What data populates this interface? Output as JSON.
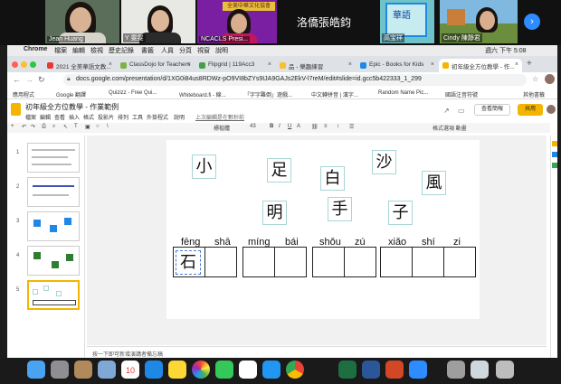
{
  "video_strip": {
    "participants": [
      "Jean Huang",
      "Y 雯雯",
      "NCACLS Presi...",
      "高宝祥",
      "Cindy 陳靜君"
    ],
    "logo_text": "全美中華文化協會",
    "book_title": "華語",
    "speaker_caption": "洛僑張皓鈞",
    "next_icon": "chevron-right-icon"
  },
  "menubar": {
    "items": [
      "Chrome",
      "檔案",
      "編輯",
      "檢視",
      "歷史記錄",
      "書籤",
      "人員",
      "分頁",
      "視窗",
      "說明"
    ],
    "clock": "週六 下午 5:08"
  },
  "browser": {
    "tabs": [
      {
        "label": "2021 全美華語文教...",
        "color": "#e53935"
      },
      {
        "label": "ClassDojo for Teachers",
        "color": "#7cb342"
      },
      {
        "label": "Flipgrid | 119Acc3",
        "color": "#43a047"
      },
      {
        "label": "品 - 樂趣練習",
        "color": "#fbc02d"
      },
      {
        "label": "Epic - Books for Kids",
        "color": "#1e88e5"
      },
      {
        "label": "初年級全方位教學 - 作...",
        "color": "#f4b400"
      }
    ],
    "url": "docs.google.com/presentation/d/1XG0i84us8RDWz-pO9VI8bZYs9IJA9GAJs2EkV-l7reM/edit#slide=id.gcc5b422333_1_299",
    "bookmarks": [
      "應用程式",
      "Google 翻譯",
      "Quizizz - Free Qui...",
      "Whiteboard.fi - 線...",
      "「字字難倒」遊戲...",
      "中文轉拼音 | 漢字...",
      "Random Name Pic...",
      "國語注音符號",
      "其他書籤"
    ]
  },
  "slides": {
    "doc_title": "初年級全方位教學 - 作業範例",
    "menu": [
      "檔案",
      "編輯",
      "查看",
      "插入",
      "格式",
      "投影片",
      "排列",
      "工具",
      "外掛程式",
      "說明"
    ],
    "last_edit": "上次編輯是在數秒前",
    "present_label": "查看簡報",
    "share_label": "共用",
    "toolbar_font": "標楷體",
    "toolbar_size": "43",
    "toolbar_right": "格式選項   動畫",
    "slide_numbers": [
      "1",
      "2",
      "3",
      "4",
      "5"
    ],
    "notes_placeholder": "按一下即可新增演講者備忘稿"
  },
  "slide": {
    "cards": [
      "小",
      "足",
      "白",
      "沙",
      "風",
      "明",
      "手",
      "子"
    ],
    "pinyin": [
      "fēng",
      "shā",
      "míng",
      "bái",
      "shǒu",
      "zú",
      "xiǎo",
      "shí",
      "zi"
    ],
    "answer_char": "石"
  },
  "dock": {
    "icons": [
      "finder-icon",
      "launchpad-icon",
      "notes-icon",
      "preview-icon",
      "calendar-icon",
      "safari-icon",
      "stickies-icon",
      "photos-icon",
      "messages-icon",
      "music-icon",
      "app-store-icon",
      "chrome-icon",
      "excel-icon",
      "word-icon",
      "powerpoint-icon",
      "zoom-icon",
      "screenshot-icon",
      "downloads-icon",
      "trash-icon"
    ],
    "calendar_day": "10"
  },
  "colors": {
    "accent_blue": "#2d8cff",
    "card_border": "#a8d6d4",
    "share_button": "#f4b400"
  }
}
